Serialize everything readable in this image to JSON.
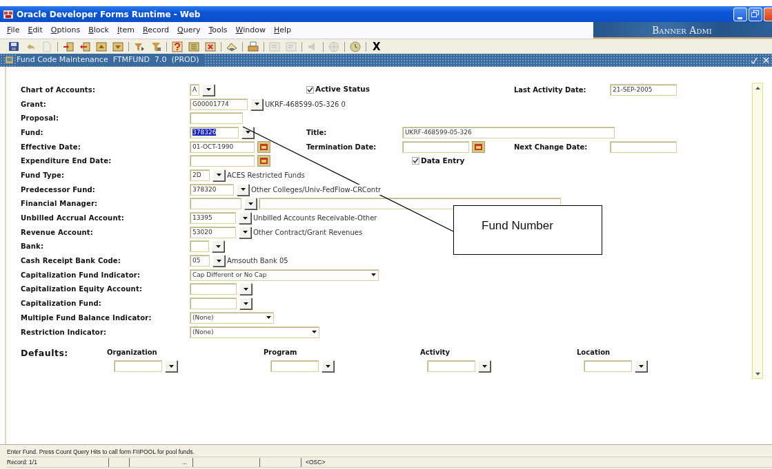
{
  "window": {
    "title": "Oracle Developer Forms Runtime - Web"
  },
  "menu": [
    "File",
    "Edit",
    "Options",
    "Block",
    "Item",
    "Record",
    "Query",
    "Tools",
    "Window",
    "Help"
  ],
  "banner": "Banner Admi",
  "toolbar": [
    {
      "kind": "button",
      "disabled": false
    },
    {
      "kind": "button",
      "disabled": false
    },
    {
      "kind": "button",
      "disabled": true
    },
    {
      "kind": "separator"
    },
    {
      "kind": "button",
      "disabled": false
    },
    {
      "kind": "button",
      "disabled": false
    },
    {
      "kind": "button",
      "disabled": false
    },
    {
      "kind": "button",
      "disabled": false
    },
    {
      "kind": "separator"
    },
    {
      "kind": "button",
      "disabled": false
    },
    {
      "kind": "button",
      "disabled": false
    },
    {
      "kind": "separator"
    },
    {
      "kind": "button",
      "disabled": false
    },
    {
      "kind": "button",
      "disabled": false
    },
    {
      "kind": "button",
      "disabled": false
    },
    {
      "kind": "separator"
    },
    {
      "kind": "button",
      "disabled": false
    },
    {
      "kind": "separator"
    },
    {
      "kind": "button",
      "disabled": false
    },
    {
      "kind": "separator"
    },
    {
      "kind": "button",
      "disabled": true
    },
    {
      "kind": "button",
      "disabled": true
    },
    {
      "kind": "separator"
    },
    {
      "kind": "button",
      "disabled": true
    },
    {
      "kind": "separator"
    },
    {
      "kind": "button",
      "disabled": true
    },
    {
      "kind": "separator"
    },
    {
      "kind": "button",
      "disabled": false
    },
    {
      "kind": "separator"
    },
    {
      "kind": "text",
      "label": "X"
    }
  ],
  "form": {
    "title": "Fund Code Maintenance  FTMFUND  7.0  (PROD)",
    "rows": [
      {
        "label": "Chart of Accounts:",
        "main": [
          {
            "kind": "field",
            "value": "A"
          },
          {
            "kind": "lov"
          }
        ],
        "middle": [
          {
            "kind": "checkbox",
            "label": "Active Status",
            "checked": true
          }
        ],
        "end": [
          {
            "kind": "label",
            "text": "Last Activity Date:"
          },
          {
            "kind": "field",
            "value": "21-SEP-2005"
          }
        ]
      },
      {
        "label": "Grant:",
        "main": [
          {
            "kind": "field",
            "value": "G00001774"
          },
          {
            "kind": "lov"
          },
          {
            "kind": "text",
            "text": "UKRF-468599-05-326  0"
          }
        ]
      },
      {
        "label": "Proposal:",
        "main": [
          {
            "kind": "field"
          }
        ]
      },
      {
        "label": "Fund:",
        "main": [
          {
            "kind": "field",
            "value": "378326",
            "text_selected": true
          },
          {
            "kind": "lov"
          }
        ],
        "middle": [
          {
            "kind": "label",
            "text": "Title:"
          },
          {
            "kind": "field",
            "value": "UKRF-468599-05-326"
          }
        ]
      },
      {
        "label": "Effective Date:",
        "main": [
          {
            "kind": "field",
            "value": "01-OCT-1990"
          },
          {
            "kind": "calendar"
          }
        ],
        "middle": [
          {
            "kind": "label",
            "text": "Termination Date:"
          },
          {
            "kind": "field"
          },
          {
            "kind": "calendar"
          }
        ],
        "end": [
          {
            "kind": "label",
            "text": "Next Change Date:"
          },
          {
            "kind": "field"
          }
        ]
      },
      {
        "label": "Expenditure End Date:",
        "main": [
          {
            "kind": "field"
          },
          {
            "kind": "calendar"
          }
        ],
        "middle": [
          {
            "kind": "checkbox",
            "label": "Data Entry",
            "checked": true
          }
        ]
      },
      {
        "label": "Fund Type:",
        "main": [
          {
            "kind": "field",
            "value": "2D"
          },
          {
            "kind": "lov"
          },
          {
            "kind": "text",
            "text": "ACES Restricted Funds"
          }
        ]
      },
      {
        "label": "Predecessor Fund:",
        "main": [
          {
            "kind": "field",
            "value": "378320"
          },
          {
            "kind": "lov"
          },
          {
            "kind": "text",
            "text": "Other Colleges/Univ-FedFlow-CRContr"
          }
        ]
      },
      {
        "label": "Financial Manager:",
        "main": [
          {
            "kind": "field"
          },
          {
            "kind": "lov"
          },
          {
            "kind": "field"
          }
        ]
      },
      {
        "label": "Unbilled Accrual Account:",
        "main": [
          {
            "kind": "field",
            "value": "13395"
          },
          {
            "kind": "lov"
          },
          {
            "kind": "text",
            "text": "Unbilled Accounts Receivable-Other"
          }
        ]
      },
      {
        "label": "Revenue Account:",
        "main": [
          {
            "kind": "field",
            "value": "53020"
          },
          {
            "kind": "lov"
          },
          {
            "kind": "text",
            "text": "Other Contract/Grant Revenues"
          }
        ]
      },
      {
        "label": "Bank:",
        "main": [
          {
            "kind": "field"
          },
          {
            "kind": "lov"
          }
        ]
      },
      {
        "label": "Cash Receipt Bank Code:",
        "main": [
          {
            "kind": "field",
            "value": "05"
          },
          {
            "kind": "lov"
          },
          {
            "kind": "text",
            "text": "Amsouth Bank 05"
          }
        ]
      },
      {
        "label": "Capitalization Fund Indicator:",
        "main": [
          {
            "kind": "select",
            "value": "Cap Different or No Cap"
          }
        ]
      },
      {
        "label": "Capitalization Equity Account:",
        "main": [
          {
            "kind": "field"
          },
          {
            "kind": "lov"
          }
        ]
      },
      {
        "label": "Capitalization Fund:",
        "main": [
          {
            "kind": "field"
          },
          {
            "kind": "lov"
          }
        ]
      },
      {
        "label": "Multiple Fund Balance Indicator:",
        "main": [
          {
            "kind": "select",
            "value": "(None)"
          }
        ]
      },
      {
        "label": "Restriction Indicator:",
        "main": [
          {
            "kind": "select",
            "value": "(None)"
          }
        ]
      }
    ],
    "defaults": {
      "label": "Defaults:",
      "columns": [
        {
          "heading": "Organization"
        },
        {
          "heading": "Program"
        },
        {
          "heading": "Activity"
        },
        {
          "heading": "Location"
        }
      ]
    },
    "callout": "Fund Number"
  },
  "status_bar": {
    "message": "Enter Fund. Press Count Query Hits to call form FIIPOOL for pool funds.",
    "record": "Record: 1/1",
    "ellipsis": "...",
    "mode": "<OSC>"
  }
}
